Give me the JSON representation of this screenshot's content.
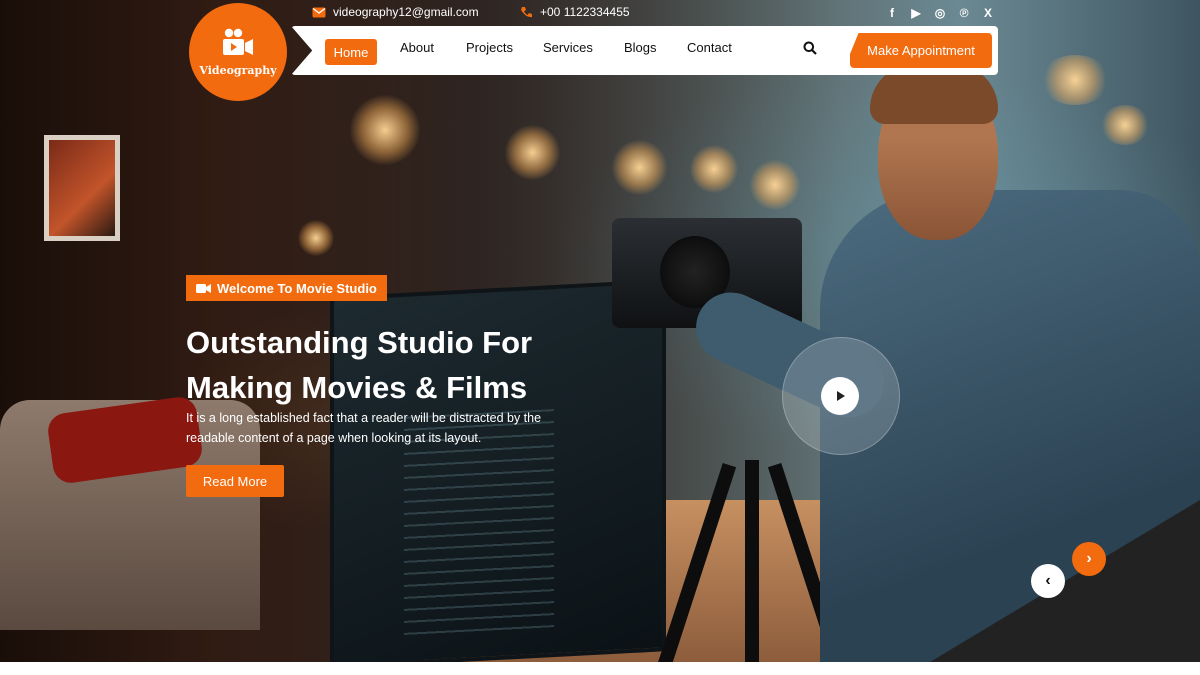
{
  "topbar": {
    "email": "videography12@gmail.com",
    "phone": "+00 1122334455",
    "social": [
      {
        "name": "facebook-icon",
        "glyph": "f"
      },
      {
        "name": "youtube-icon",
        "glyph": "▶"
      },
      {
        "name": "instagram-icon",
        "glyph": "◎"
      },
      {
        "name": "pinterest-icon",
        "glyph": "℗"
      },
      {
        "name": "x-icon",
        "glyph": "X"
      }
    ]
  },
  "logo": {
    "brand": "Videography"
  },
  "nav": {
    "items": [
      "Home",
      "About",
      "Projects",
      "Services",
      "Blogs",
      "Contact"
    ],
    "active": "Home",
    "cta": "Make Appointment"
  },
  "hero": {
    "badge": "Welcome To Movie Studio",
    "title_line1": "Outstanding Studio For",
    "title_line2": "Making Movies & Films",
    "description": "It is a long established fact that a reader will be distracted by the readable content of a page when looking at its layout.",
    "button": "Read More"
  },
  "slider": {
    "prev": "‹",
    "next": "›"
  },
  "colors": {
    "accent": "#f26b0f",
    "dark_corner": "#222222"
  }
}
